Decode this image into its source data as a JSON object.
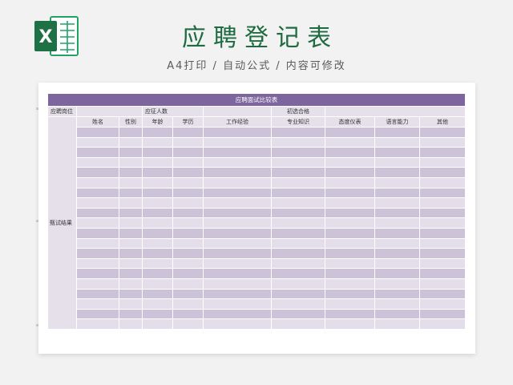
{
  "header": {
    "title": "应聘登记表",
    "subtitle": "A4打印 / 自动公式 / 内容可修改",
    "logo_icon": "excel-icon",
    "logo_letter": "X",
    "accent_color": "#1e6b40"
  },
  "sheet": {
    "title": "应聘面试比较表",
    "info_row": {
      "position_label": "应聘岗位",
      "headcount_label": "应征人数",
      "passed_label": "初选合格"
    },
    "side_label": "甄试结果",
    "columns": [
      "姓名",
      "性别",
      "年龄",
      "学历",
      "工作经验",
      "专业知识",
      "态度仪表",
      "语言能力",
      "其他"
    ],
    "data_row_count": 20,
    "colors": {
      "header_bar": "#7d659d",
      "row_dark": "#cdc3d9",
      "row_light": "#e3deea",
      "label_bg": "#e5e0ea"
    }
  }
}
